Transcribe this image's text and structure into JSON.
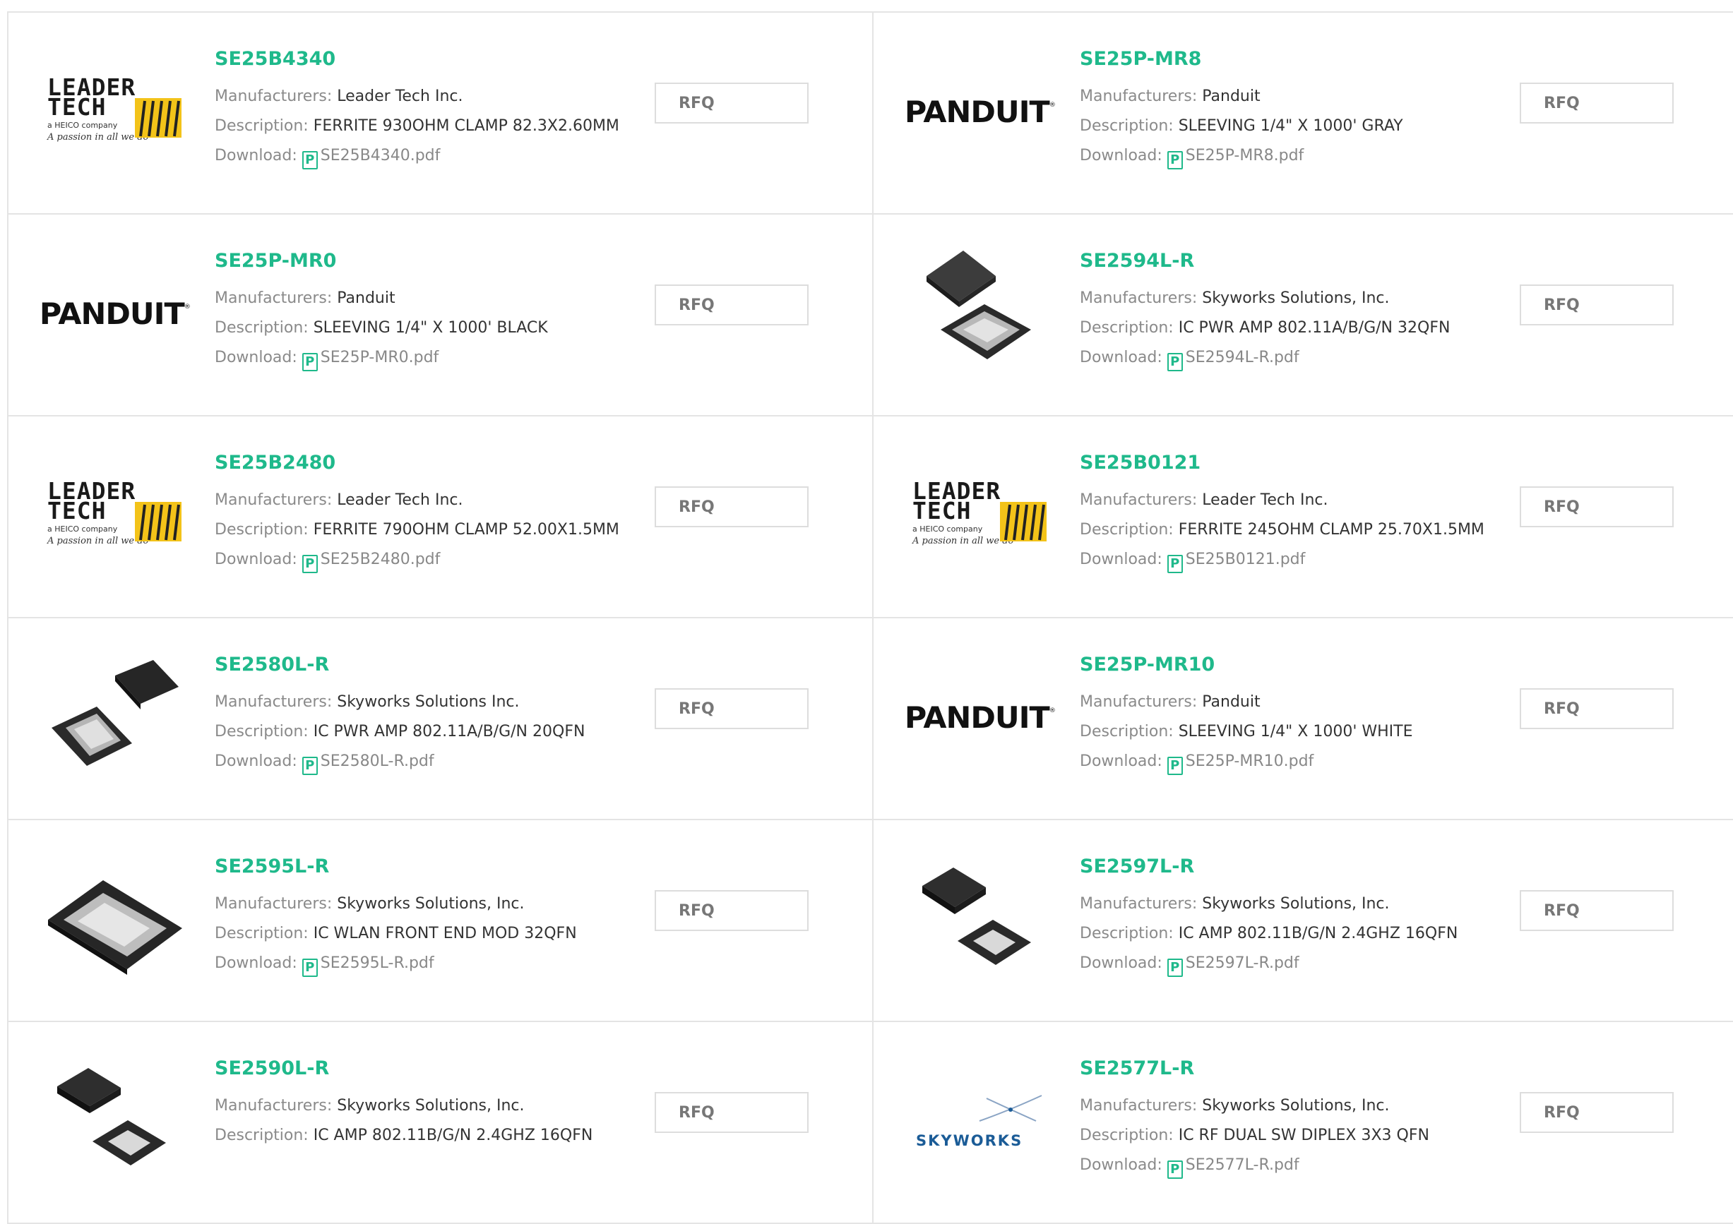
{
  "labels": {
    "manufacturers": "Manufacturers:",
    "description": "Description:",
    "download": "Download:",
    "rfq": "RFQ",
    "pdf_glyph": "P"
  },
  "logos": {
    "leader_line1": "LEADER",
    "leader_line2": "TECH",
    "leader_tagline": "a HEICO company",
    "leader_slogan": "A passion in all we do",
    "panduit": "PANDUIT",
    "skyworks": "SKYWORKS"
  },
  "products": [
    {
      "part": "SE25B4340",
      "manufacturer": "Leader Tech Inc.",
      "description": "FERRITE 930OHM CLAMP 82.3X2.60MM",
      "file": "SE25B4340.pdf",
      "image": "leader-tech-logo"
    },
    {
      "part": "SE25P-MR8",
      "manufacturer": "Panduit",
      "description": "SLEEVING 1/4\" X 1000' GRAY",
      "file": "SE25P-MR8.pdf",
      "image": "panduit-logo"
    },
    {
      "part": "SE25P-MR0",
      "manufacturer": "Panduit",
      "description": "SLEEVING 1/4\" X 1000' BLACK",
      "file": "SE25P-MR0.pdf",
      "image": "panduit-logo"
    },
    {
      "part": "SE2594L-R",
      "manufacturer": "Skyworks Solutions, Inc.",
      "description": "IC PWR AMP 802.11A/B/G/N 32QFN",
      "file": "SE2594L-R.pdf",
      "image": "qfn-chip-photo"
    },
    {
      "part": "SE25B2480",
      "manufacturer": "Leader Tech Inc.",
      "description": "FERRITE 790OHM CLAMP 52.00X1.5MM",
      "file": "SE25B2480.pdf",
      "image": "leader-tech-logo"
    },
    {
      "part": "SE25B0121",
      "manufacturer": "Leader Tech Inc.",
      "description": "FERRITE 245OHM CLAMP 25.70X1.5MM",
      "file": "SE25B0121.pdf",
      "image": "leader-tech-logo"
    },
    {
      "part": "SE2580L-R",
      "manufacturer": "Skyworks Solutions Inc.",
      "description": "IC PWR AMP 802.11A/B/G/N 20QFN",
      "file": "SE2580L-R.pdf",
      "image": "qfn-chip-photo"
    },
    {
      "part": "SE25P-MR10",
      "manufacturer": "Panduit",
      "description": "SLEEVING 1/4\" X 1000' WHITE",
      "file": "SE25P-MR10.pdf",
      "image": "panduit-logo"
    },
    {
      "part": "SE2595L-R",
      "manufacturer": "Skyworks Solutions, Inc.",
      "description": "IC WLAN FRONT END MOD 32QFN",
      "file": "SE2595L-R.pdf",
      "image": "qfn-chip-photo"
    },
    {
      "part": "SE2597L-R",
      "manufacturer": "Skyworks Solutions, Inc.",
      "description": "IC AMP 802.11B/G/N 2.4GHZ 16QFN",
      "file": "SE2597L-R.pdf",
      "image": "qfn-chip-photo"
    },
    {
      "part": "SE2590L-R",
      "manufacturer": "Skyworks Solutions, Inc.",
      "description": "IC AMP 802.11B/G/N 2.4GHZ 16QFN",
      "file": null,
      "image": "qfn-chip-photo"
    },
    {
      "part": "SE2577L-R",
      "manufacturer": "Skyworks Solutions, Inc.",
      "description": "IC RF DUAL SW DIPLEX 3X3 QFN",
      "file": "SE2577L-R.pdf",
      "image": "skyworks-logo"
    }
  ],
  "colors": {
    "part_number": "#1fb98b",
    "label": "#8a8a8a",
    "border": "#e4e4e4",
    "skyworks_blue": "#1b5c97"
  }
}
